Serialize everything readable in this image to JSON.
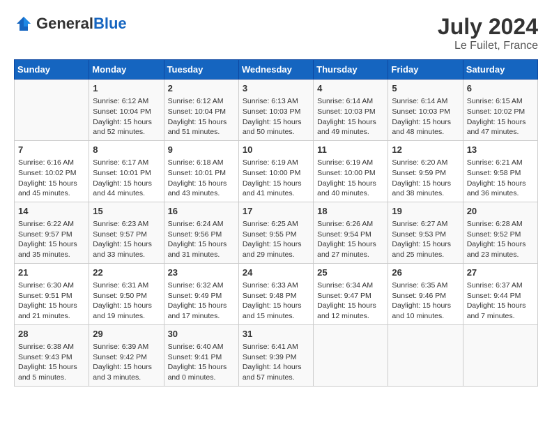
{
  "header": {
    "logo_general": "General",
    "logo_blue": "Blue",
    "month_year": "July 2024",
    "location": "Le Fuilet, France"
  },
  "columns": [
    "Sunday",
    "Monday",
    "Tuesday",
    "Wednesday",
    "Thursday",
    "Friday",
    "Saturday"
  ],
  "weeks": [
    [
      {
        "day": "",
        "content": ""
      },
      {
        "day": "1",
        "content": "Sunrise: 6:12 AM\nSunset: 10:04 PM\nDaylight: 15 hours\nand 52 minutes."
      },
      {
        "day": "2",
        "content": "Sunrise: 6:12 AM\nSunset: 10:04 PM\nDaylight: 15 hours\nand 51 minutes."
      },
      {
        "day": "3",
        "content": "Sunrise: 6:13 AM\nSunset: 10:03 PM\nDaylight: 15 hours\nand 50 minutes."
      },
      {
        "day": "4",
        "content": "Sunrise: 6:14 AM\nSunset: 10:03 PM\nDaylight: 15 hours\nand 49 minutes."
      },
      {
        "day": "5",
        "content": "Sunrise: 6:14 AM\nSunset: 10:03 PM\nDaylight: 15 hours\nand 48 minutes."
      },
      {
        "day": "6",
        "content": "Sunrise: 6:15 AM\nSunset: 10:02 PM\nDaylight: 15 hours\nand 47 minutes."
      }
    ],
    [
      {
        "day": "7",
        "content": "Sunrise: 6:16 AM\nSunset: 10:02 PM\nDaylight: 15 hours\nand 45 minutes."
      },
      {
        "day": "8",
        "content": "Sunrise: 6:17 AM\nSunset: 10:01 PM\nDaylight: 15 hours\nand 44 minutes."
      },
      {
        "day": "9",
        "content": "Sunrise: 6:18 AM\nSunset: 10:01 PM\nDaylight: 15 hours\nand 43 minutes."
      },
      {
        "day": "10",
        "content": "Sunrise: 6:19 AM\nSunset: 10:00 PM\nDaylight: 15 hours\nand 41 minutes."
      },
      {
        "day": "11",
        "content": "Sunrise: 6:19 AM\nSunset: 10:00 PM\nDaylight: 15 hours\nand 40 minutes."
      },
      {
        "day": "12",
        "content": "Sunrise: 6:20 AM\nSunset: 9:59 PM\nDaylight: 15 hours\nand 38 minutes."
      },
      {
        "day": "13",
        "content": "Sunrise: 6:21 AM\nSunset: 9:58 PM\nDaylight: 15 hours\nand 36 minutes."
      }
    ],
    [
      {
        "day": "14",
        "content": "Sunrise: 6:22 AM\nSunset: 9:57 PM\nDaylight: 15 hours\nand 35 minutes."
      },
      {
        "day": "15",
        "content": "Sunrise: 6:23 AM\nSunset: 9:57 PM\nDaylight: 15 hours\nand 33 minutes."
      },
      {
        "day": "16",
        "content": "Sunrise: 6:24 AM\nSunset: 9:56 PM\nDaylight: 15 hours\nand 31 minutes."
      },
      {
        "day": "17",
        "content": "Sunrise: 6:25 AM\nSunset: 9:55 PM\nDaylight: 15 hours\nand 29 minutes."
      },
      {
        "day": "18",
        "content": "Sunrise: 6:26 AM\nSunset: 9:54 PM\nDaylight: 15 hours\nand 27 minutes."
      },
      {
        "day": "19",
        "content": "Sunrise: 6:27 AM\nSunset: 9:53 PM\nDaylight: 15 hours\nand 25 minutes."
      },
      {
        "day": "20",
        "content": "Sunrise: 6:28 AM\nSunset: 9:52 PM\nDaylight: 15 hours\nand 23 minutes."
      }
    ],
    [
      {
        "day": "21",
        "content": "Sunrise: 6:30 AM\nSunset: 9:51 PM\nDaylight: 15 hours\nand 21 minutes."
      },
      {
        "day": "22",
        "content": "Sunrise: 6:31 AM\nSunset: 9:50 PM\nDaylight: 15 hours\nand 19 minutes."
      },
      {
        "day": "23",
        "content": "Sunrise: 6:32 AM\nSunset: 9:49 PM\nDaylight: 15 hours\nand 17 minutes."
      },
      {
        "day": "24",
        "content": "Sunrise: 6:33 AM\nSunset: 9:48 PM\nDaylight: 15 hours\nand 15 minutes."
      },
      {
        "day": "25",
        "content": "Sunrise: 6:34 AM\nSunset: 9:47 PM\nDaylight: 15 hours\nand 12 minutes."
      },
      {
        "day": "26",
        "content": "Sunrise: 6:35 AM\nSunset: 9:46 PM\nDaylight: 15 hours\nand 10 minutes."
      },
      {
        "day": "27",
        "content": "Sunrise: 6:37 AM\nSunset: 9:44 PM\nDaylight: 15 hours\nand 7 minutes."
      }
    ],
    [
      {
        "day": "28",
        "content": "Sunrise: 6:38 AM\nSunset: 9:43 PM\nDaylight: 15 hours\nand 5 minutes."
      },
      {
        "day": "29",
        "content": "Sunrise: 6:39 AM\nSunset: 9:42 PM\nDaylight: 15 hours\nand 3 minutes."
      },
      {
        "day": "30",
        "content": "Sunrise: 6:40 AM\nSunset: 9:41 PM\nDaylight: 15 hours\nand 0 minutes."
      },
      {
        "day": "31",
        "content": "Sunrise: 6:41 AM\nSunset: 9:39 PM\nDaylight: 14 hours\nand 57 minutes."
      },
      {
        "day": "",
        "content": ""
      },
      {
        "day": "",
        "content": ""
      },
      {
        "day": "",
        "content": ""
      }
    ]
  ]
}
